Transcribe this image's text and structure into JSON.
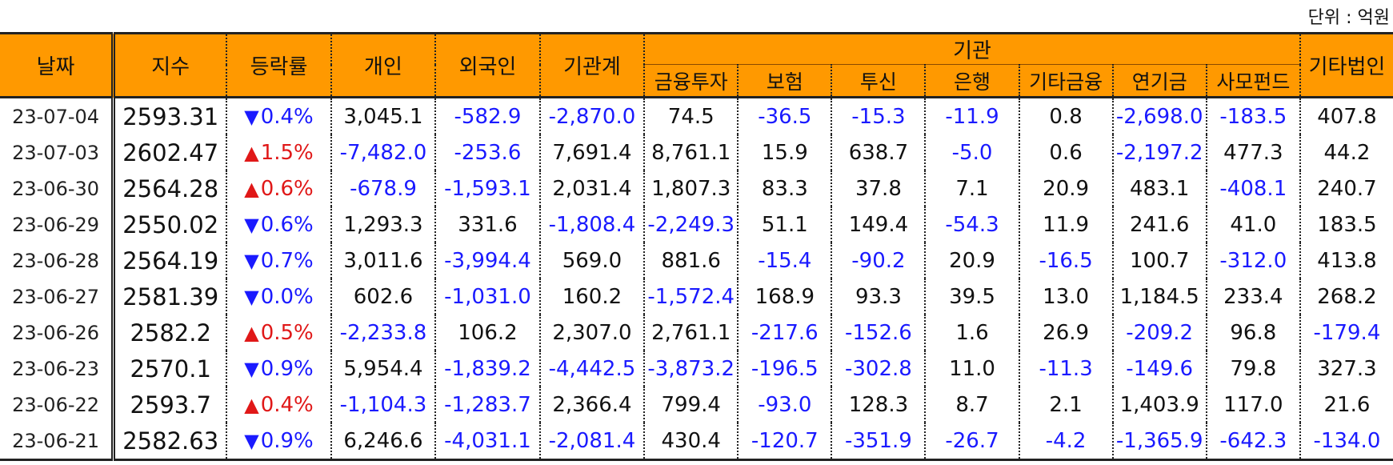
{
  "unit_label": "단위 : 억원",
  "headers": {
    "date": "날짜",
    "index": "지수",
    "change": "등락률",
    "individual": "개인",
    "foreign": "외국인",
    "inst_total": "기관계",
    "institution_group": "기관",
    "sub": [
      "금융투자",
      "보험",
      "투신",
      "은행",
      "기타금융",
      "연기금",
      "사모펀드"
    ],
    "other_corp": "기타법인"
  },
  "rows": [
    {
      "date": "23-07-04",
      "index": "2593.31",
      "dir": "down",
      "change": "0.4%",
      "individual": "3,045.1",
      "foreign": "-582.9",
      "inst_total": "-2,870.0",
      "fin": "74.5",
      "ins": "-36.5",
      "trust": "-15.3",
      "bank": "-11.9",
      "etcfin": "0.8",
      "pension": "-2,698.0",
      "pe": "-183.5",
      "other": "407.8"
    },
    {
      "date": "23-07-03",
      "index": "2602.47",
      "dir": "up",
      "change": "1.5%",
      "individual": "-7,482.0",
      "foreign": "-253.6",
      "inst_total": "7,691.4",
      "fin": "8,761.1",
      "ins": "15.9",
      "trust": "638.7",
      "bank": "-5.0",
      "etcfin": "0.6",
      "pension": "-2,197.2",
      "pe": "477.3",
      "other": "44.2"
    },
    {
      "date": "23-06-30",
      "index": "2564.28",
      "dir": "up",
      "change": "0.6%",
      "individual": "-678.9",
      "foreign": "-1,593.1",
      "inst_total": "2,031.4",
      "fin": "1,807.3",
      "ins": "83.3",
      "trust": "37.8",
      "bank": "7.1",
      "etcfin": "20.9",
      "pension": "483.1",
      "pe": "-408.1",
      "other": "240.7"
    },
    {
      "date": "23-06-29",
      "index": "2550.02",
      "dir": "down",
      "change": "0.6%",
      "individual": "1,293.3",
      "foreign": "331.6",
      "inst_total": "-1,808.4",
      "fin": "-2,249.3",
      "ins": "51.1",
      "trust": "149.4",
      "bank": "-54.3",
      "etcfin": "11.9",
      "pension": "241.6",
      "pe": "41.0",
      "other": "183.5"
    },
    {
      "date": "23-06-28",
      "index": "2564.19",
      "dir": "down",
      "change": "0.7%",
      "individual": "3,011.6",
      "foreign": "-3,994.4",
      "inst_total": "569.0",
      "fin": "881.6",
      "ins": "-15.4",
      "trust": "-90.2",
      "bank": "20.9",
      "etcfin": "-16.5",
      "pension": "100.7",
      "pe": "-312.0",
      "other": "413.8"
    },
    {
      "date": "23-06-27",
      "index": "2581.39",
      "dir": "down",
      "change": "0.0%",
      "individual": "602.6",
      "foreign": "-1,031.0",
      "inst_total": "160.2",
      "fin": "-1,572.4",
      "ins": "168.9",
      "trust": "93.3",
      "bank": "39.5",
      "etcfin": "13.0",
      "pension": "1,184.5",
      "pe": "233.4",
      "other": "268.2"
    },
    {
      "date": "23-06-26",
      "index": "2582.2",
      "dir": "up",
      "change": "0.5%",
      "individual": "-2,233.8",
      "foreign": "106.2",
      "inst_total": "2,307.0",
      "fin": "2,761.1",
      "ins": "-217.6",
      "trust": "-152.6",
      "bank": "1.6",
      "etcfin": "26.9",
      "pension": "-209.2",
      "pe": "96.8",
      "other": "-179.4"
    },
    {
      "date": "23-06-23",
      "index": "2570.1",
      "dir": "down",
      "change": "0.9%",
      "individual": "5,954.4",
      "foreign": "-1,839.2",
      "inst_total": "-4,442.5",
      "fin": "-3,873.2",
      "ins": "-196.5",
      "trust": "-302.8",
      "bank": "11.0",
      "etcfin": "-11.3",
      "pension": "-149.6",
      "pe": "79.8",
      "other": "327.3"
    },
    {
      "date": "23-06-22",
      "index": "2593.7",
      "dir": "up",
      "change": "0.4%",
      "individual": "-1,104.3",
      "foreign": "-1,283.7",
      "inst_total": "2,366.4",
      "fin": "799.4",
      "ins": "-93.0",
      "trust": "128.3",
      "bank": "8.7",
      "etcfin": "2.1",
      "pension": "1,403.9",
      "pe": "117.0",
      "other": "21.6"
    },
    {
      "date": "23-06-21",
      "index": "2582.63",
      "dir": "down",
      "change": "0.9%",
      "individual": "6,246.6",
      "foreign": "-4,031.1",
      "inst_total": "-2,081.4",
      "fin": "430.4",
      "ins": "-120.7",
      "trust": "-351.9",
      "bank": "-26.7",
      "etcfin": "-4.2",
      "pension": "-1,365.9",
      "pe": "-642.3",
      "other": "-134.0"
    }
  ],
  "colors": {
    "header_bg": "#ff9900",
    "negative": "#1a1aff",
    "up": "#e01818",
    "down": "#1a1aff"
  },
  "icons": {
    "up": "triangle-up-icon",
    "down": "triangle-down-icon"
  }
}
